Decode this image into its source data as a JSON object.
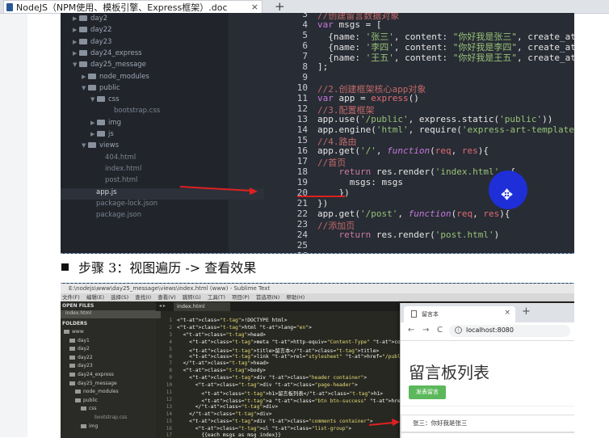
{
  "doc_tab": {
    "title": "NodeJS（NPM使用、模板引擎、Express框架）.doc",
    "close": "×",
    "new_tab": "+"
  },
  "editor1": {
    "tree": [
      {
        "label": "day2",
        "type": "folder",
        "depth": 1
      },
      {
        "label": "day22",
        "type": "folder",
        "depth": 1
      },
      {
        "label": "day23",
        "type": "folder",
        "depth": 1
      },
      {
        "label": "day24_express",
        "type": "folder",
        "depth": 1
      },
      {
        "label": "day25_message",
        "type": "folder-open",
        "depth": 1
      },
      {
        "label": "node_modules",
        "type": "folder",
        "depth": 2
      },
      {
        "label": "public",
        "type": "folder-open",
        "depth": 2
      },
      {
        "label": "css",
        "type": "folder-open",
        "depth": 3
      },
      {
        "label": "bootstrap.css",
        "type": "file",
        "depth": 4
      },
      {
        "label": "img",
        "type": "folder",
        "depth": 3
      },
      {
        "label": "js",
        "type": "folder",
        "depth": 3
      },
      {
        "label": "views",
        "type": "folder-open",
        "depth": 2
      },
      {
        "label": "404.html",
        "type": "file",
        "depth": 3
      },
      {
        "label": "index.html",
        "type": "file",
        "depth": 3
      },
      {
        "label": "post.html",
        "type": "file",
        "depth": 3
      },
      {
        "label": "app.js",
        "type": "file-sel",
        "depth": 2
      },
      {
        "label": "package-lock.json",
        "type": "file",
        "depth": 2
      },
      {
        "label": "package.json",
        "type": "file",
        "depth": 2
      }
    ],
    "line_numbers": [
      "3",
      "4",
      "5",
      "6",
      "7",
      "8",
      "9",
      "10",
      "11",
      "12",
      "13",
      "14",
      "15",
      "16",
      "17",
      "18",
      "19",
      "20",
      "21",
      "22",
      "23",
      "24",
      "25",
      "26"
    ],
    "lines": [
      [
        {
          "t": "//创建留言数据对象",
          "c": "c-cm"
        }
      ],
      [
        {
          "t": "var ",
          "c": "c-kw"
        },
        {
          "t": "msgs = ["
        }
      ],
      [
        {
          "t": "  {name: "
        },
        {
          "t": "'张三'",
          "c": "c-str"
        },
        {
          "t": ", content: "
        },
        {
          "t": "\"你好我是张三\"",
          "c": "c-str"
        },
        {
          "t": ", create_at: "
        },
        {
          "t": "'2017-11-14 10",
          "c": "c-str"
        }
      ],
      [
        {
          "t": "  {name: "
        },
        {
          "t": "'李四'",
          "c": "c-str"
        },
        {
          "t": ", content: "
        },
        {
          "t": "\"你好我是李四\"",
          "c": "c-str"
        },
        {
          "t": ", create_at: "
        },
        {
          "t": "'2017-11-15 10",
          "c": "c-str"
        }
      ],
      [
        {
          "t": "  {name: "
        },
        {
          "t": "'王五'",
          "c": "c-str"
        },
        {
          "t": ", content: "
        },
        {
          "t": "\"你好我是王五\"",
          "c": "c-str"
        },
        {
          "t": ", create_at: "
        },
        {
          "t": "'2017-11-16 10",
          "c": "c-str"
        }
      ],
      [
        {
          "t": "];"
        }
      ],
      [
        {
          "t": ""
        }
      ],
      [
        {
          "t": "//2.创建框架核心app对象",
          "c": "c-cm"
        }
      ],
      [
        {
          "t": "var ",
          "c": "c-kw"
        },
        {
          "t": "app = "
        },
        {
          "t": "express",
          "c": "c-id"
        },
        {
          "t": "()"
        }
      ],
      [
        {
          "t": "//3.配置框架",
          "c": "c-cm"
        }
      ],
      [
        {
          "t": "app.use("
        },
        {
          "t": "'/public'",
          "c": "c-str"
        },
        {
          "t": ", express.static("
        },
        {
          "t": "'public'",
          "c": "c-str"
        },
        {
          "t": "))"
        }
      ],
      [
        {
          "t": "app.engine("
        },
        {
          "t": "'html'",
          "c": "c-str"
        },
        {
          "t": ", require("
        },
        {
          "t": "'express-art-template'",
          "c": "c-str"
        },
        {
          "t": "))"
        }
      ],
      [
        {
          "t": "//4.路由",
          "c": "c-cm"
        }
      ],
      [
        {
          "t": "app.get("
        },
        {
          "t": "'/'",
          "c": "c-str"
        },
        {
          "t": ", "
        },
        {
          "t": "function",
          "c": "c-it"
        },
        {
          "t": "("
        },
        {
          "t": "req",
          "c": "c-id"
        },
        {
          "t": ", "
        },
        {
          "t": "res",
          "c": "c-id"
        },
        {
          "t": "){"
        }
      ],
      [
        {
          "t": "//首页",
          "c": "c-cm"
        }
      ],
      [
        {
          "t": "    "
        },
        {
          "t": "return ",
          "c": "c-kw2"
        },
        {
          "t": "res.render("
        },
        {
          "t": "'index.html'",
          "c": "c-str"
        },
        {
          "t": ", {"
        }
      ],
      [
        {
          "t": "      msgs: msgs"
        }
      ],
      [
        {
          "t": "    })"
        }
      ],
      [
        {
          "t": "})"
        }
      ],
      [
        {
          "t": "app.get("
        },
        {
          "t": "'/post'",
          "c": "c-str"
        },
        {
          "t": ", "
        },
        {
          "t": "function",
          "c": "c-it"
        },
        {
          "t": "("
        },
        {
          "t": "req",
          "c": "c-id"
        },
        {
          "t": ", "
        },
        {
          "t": "res",
          "c": "c-id"
        },
        {
          "t": "){"
        }
      ],
      [
        {
          "t": "//添加页",
          "c": "c-cm"
        }
      ],
      [
        {
          "t": "    "
        },
        {
          "t": "return ",
          "c": "c-kw2"
        },
        {
          "t": "res.render("
        },
        {
          "t": "'post.html'",
          "c": "c-str"
        },
        {
          "t": ")"
        }
      ]
    ],
    "accent": "#1e2fd8"
  },
  "step": {
    "label": "步骤 3：视图遍历 -> 查看效果"
  },
  "editor2": {
    "title": "E:\\nodejs\\www\\day25_message\\views\\index.html (www) - Sublime Text",
    "menu": [
      "文件(F)",
      "编辑(E)",
      "选择(S)",
      "查找(I)",
      "查看(V)",
      "跳转(G)",
      "工具(T)",
      "项目(P)",
      "首选项(N)",
      "帮助(H)"
    ],
    "open_files_header": "OPEN FILES",
    "open_file": "index.html",
    "folders_header": "FOLDERS",
    "tree": [
      "www",
      "day1",
      "day2",
      "day22",
      "day23",
      "day24_express",
      "day25_message",
      "node_modules",
      "public",
      "css",
      "bootstrap.css",
      "img"
    ],
    "tab": "index.html",
    "tab_nav": "◂ ▸",
    "line_numbers": [
      "1",
      "2",
      "3",
      "4",
      "5",
      "6",
      "7",
      "8",
      "9",
      "10",
      "11",
      "12",
      "13",
      "14",
      "15",
      "16",
      "17"
    ],
    "lines": [
      "<!DOCTYPE html>",
      "<html lang=\"en\">",
      "  <head>",
      "    <meta http-equiv=\"Content-Type\" content=\"text/html; charset=UTF-8\">",
      "    <title>留言本</title>",
      "    <link rel=\"stylesheet\" href=\"/public/css/bootstrap.css\">",
      "  </head>",
      "  <body>",
      "    <div class=\"header container\">",
      "      <div class=\"page-header\">",
      "        <h1>留言板列表</h1>",
      "        <a class=\"btn btn-success\" href=\"###\">发表留言</a>",
      "      </div>",
      "    </div>",
      "    <div class=\"comments container\">",
      "      <ul class=\"list-group\">",
      "        {{each msgs as msg index}}"
    ]
  },
  "browser": {
    "tab_title": "留言本",
    "tab_close": "×",
    "new_tab": "+",
    "back": "←",
    "forward": "→",
    "reload": "C",
    "info": "i",
    "url": "localhost:8080",
    "heading": "留言板列表",
    "button": "发表留言",
    "item1": "张三：你好我是张三",
    "button_color": "#5cb85c"
  }
}
